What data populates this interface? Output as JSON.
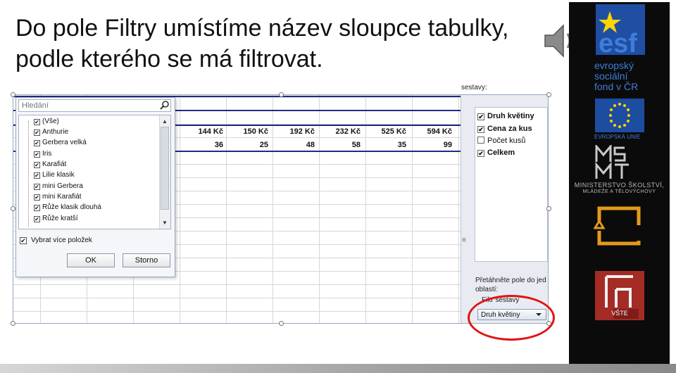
{
  "slide": {
    "title": "Do pole Filtry umístíme název sloupce tabulky, podle kterého se má filtrovat."
  },
  "sidebar": {
    "esf_line1": "evropský",
    "esf_line2": "sociální",
    "esf_line3": "fond v ČR",
    "eu_caption": "EVROPSKÁ UNIE",
    "msmt_caption1": "MINISTERSTVO ŠKOLSTVÍ,",
    "msmt_caption2": "MLÁDEŽE A TĚLOVÝCHOVY",
    "vste_caption": "VŠTE"
  },
  "sheet": {
    "prices": [
      "144 Kč",
      "150 Kč",
      "192 Kč",
      "232 Kč",
      "525 Kč",
      "594 Kč"
    ],
    "counts": [
      "36",
      "25",
      "48",
      "58",
      "35",
      "99"
    ]
  },
  "filter_dialog": {
    "search_placeholder": "Hledání",
    "items": [
      "(Vše)",
      "Anthurie",
      "Gerbera velká",
      "Iris",
      "Karafiát",
      "Lilie klasik",
      "mini Gerbera",
      "mini Karafiát",
      "Růže klasik dlouhá",
      "Růže kratší"
    ],
    "multi_select_label": "Vybrat více položek",
    "ok_label": "OK",
    "cancel_label": "Storno"
  },
  "field_pane": {
    "header": "sestavy:",
    "fields": [
      {
        "label": "Druh květiny",
        "checked": true
      },
      {
        "label": "Cena za kus",
        "checked": true
      },
      {
        "label": "Počet kusů",
        "checked": false
      },
      {
        "label": "Celkem",
        "checked": true
      }
    ],
    "drag_header1": "Přetáhněte pole do jed",
    "drag_header2": "oblastí:",
    "filter_label": "Filtr sestavy",
    "filter_chip": "Druh květiny"
  }
}
